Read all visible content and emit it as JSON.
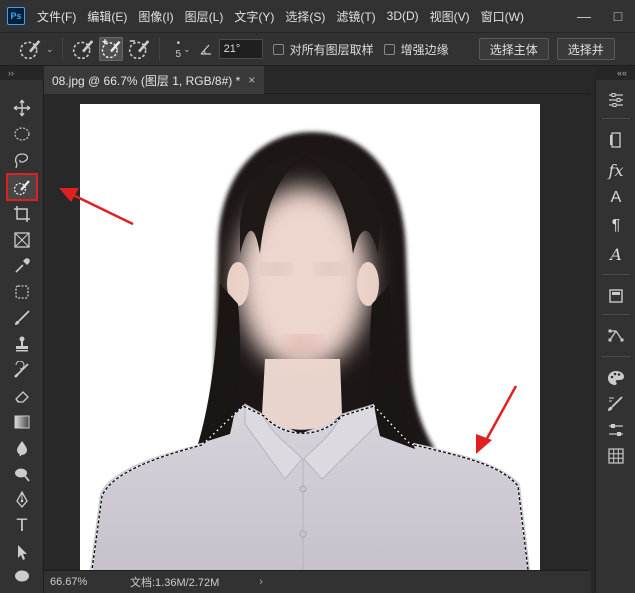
{
  "app": {
    "logo": "Ps"
  },
  "menu": [
    "文件(F)",
    "编辑(E)",
    "图像(I)",
    "图层(L)",
    "文字(Y)",
    "选择(S)",
    "滤镜(T)",
    "3D(D)",
    "视图(V)",
    "窗口(W)"
  ],
  "window_controls": {
    "minimize": "—",
    "maximize": "□"
  },
  "options": {
    "brush_size": "5",
    "angle": "21°",
    "sample_all_layers": "对所有图层取样",
    "enhance_edge": "增强边缘",
    "select_subject": "选择主体",
    "select_and_mask": "选择并"
  },
  "panel_collapse": {
    "left": "››",
    "right": "««"
  },
  "tab": {
    "title": "08.jpg @ 66.7% (图层 1, RGB/8#) *",
    "close": "×"
  },
  "status": {
    "zoom": "66.67%",
    "doc_info": "文档:1.36M/2.72M",
    "arrow": "›"
  },
  "right_panel_text": {
    "fx": "fx",
    "char": "A",
    "para": "¶",
    "glyph": "A"
  },
  "tool_text": {
    "type": "T"
  },
  "colors": {
    "accent_red": "#e02020",
    "selection": "#ffffff",
    "bg": "#282828",
    "panel": "#323232"
  }
}
